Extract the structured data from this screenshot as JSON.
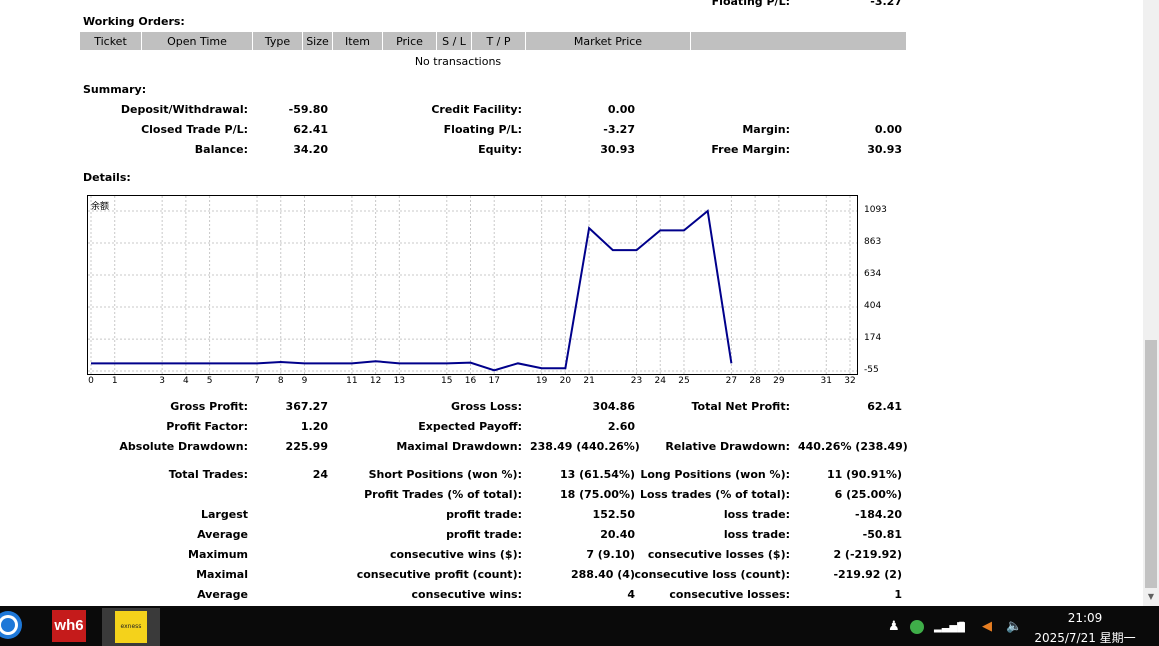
{
  "header_partial": {
    "floating_label": "Floating P/L:",
    "floating_value": "-3.27"
  },
  "working_orders": {
    "title": "Working Orders:",
    "columns": [
      "Ticket",
      "Open Time",
      "Type",
      "Size",
      "Item",
      "Price",
      "S / L",
      "T / P",
      "Market Price",
      ""
    ],
    "empty_text": "No transactions"
  },
  "summary": {
    "title": "Summary:",
    "deposit_label": "Deposit/Withdrawal:",
    "deposit_value": "-59.80",
    "credit_label": "Credit Facility:",
    "credit_value": "0.00",
    "closed_label": "Closed Trade P/L:",
    "closed_value": "62.41",
    "floating_label": "Floating P/L:",
    "floating_value": "-3.27",
    "margin_label": "Margin:",
    "margin_value": "0.00",
    "balance_label": "Balance:",
    "balance_value": "34.20",
    "equity_label": "Equity:",
    "equity_value": "30.93",
    "free_margin_label": "Free Margin:",
    "free_margin_value": "30.93"
  },
  "details": {
    "title": "Details:"
  },
  "chart_data": {
    "type": "line",
    "title": "余额",
    "yticks": [
      "1093",
      "863",
      "634",
      "404",
      "174",
      "-55"
    ],
    "ytick_values": [
      1093,
      863,
      634,
      404,
      174,
      -55
    ],
    "xticks": [
      "0",
      "1",
      "3",
      "4",
      "5",
      "7",
      "8",
      "9",
      "11",
      "12",
      "13",
      "15",
      "16",
      "17",
      "19",
      "20",
      "21",
      "23",
      "24",
      "25",
      "27",
      "28",
      "29",
      "31",
      "32"
    ],
    "ylim": [
      -55,
      1093
    ],
    "x": [
      0,
      1,
      2,
      3,
      4,
      5,
      6,
      7,
      8,
      9,
      10,
      11,
      12,
      13,
      14,
      15,
      16,
      17,
      18,
      19,
      20,
      21,
      22,
      23,
      24,
      25,
      26,
      27
    ],
    "values": [
      0,
      0,
      0,
      0,
      0,
      0,
      0,
      0,
      10,
      0,
      0,
      0,
      15,
      0,
      0,
      0,
      5,
      -50,
      0,
      -35,
      -35,
      970,
      812,
      812,
      954,
      954,
      1093,
      0
    ],
    "line_color": "#00008b",
    "grid": true
  },
  "stats": {
    "gross_profit_label": "Gross Profit:",
    "gross_profit_value": "367.27",
    "gross_loss_label": "Gross Loss:",
    "gross_loss_value": "304.86",
    "total_net_label": "Total Net Profit:",
    "total_net_value": "62.41",
    "profit_factor_label": "Profit Factor:",
    "profit_factor_value": "1.20",
    "expected_payoff_label": "Expected Payoff:",
    "expected_payoff_value": "2.60",
    "abs_dd_label": "Absolute Drawdown:",
    "abs_dd_value": "225.99",
    "max_dd_label": "Maximal Drawdown:",
    "max_dd_value": "238.49 (440.26%)",
    "rel_dd_label": "Relative Drawdown:",
    "rel_dd_value": "440.26% (238.49)",
    "total_trades_label": "Total Trades:",
    "total_trades_value": "24",
    "short_label": "Short Positions (won %):",
    "short_value": "13 (61.54%)",
    "long_label": "Long Positions (won %):",
    "long_value": "11 (90.91%)",
    "profit_trades_label": "Profit Trades (% of total):",
    "profit_trades_value": "18 (75.00%)",
    "loss_trades_label": "Loss trades (% of total):",
    "loss_trades_value": "6 (25.00%)",
    "largest_label": "Largest",
    "largest_profit_label": "profit trade:",
    "largest_profit_value": "152.50",
    "largest_loss_label": "loss trade:",
    "largest_loss_value": "-184.20",
    "average_label": "Average",
    "avg_profit_label": "profit trade:",
    "avg_profit_value": "20.40",
    "avg_loss_label": "loss trade:",
    "avg_loss_value": "-50.81",
    "maximum_label": "Maximum",
    "max_wins_label": "consecutive wins ($):",
    "max_wins_value": "7 (9.10)",
    "max_losses_label": "consecutive losses ($):",
    "max_losses_value": "2 (-219.92)",
    "maximal_label": "Maximal",
    "maximal_profit_label": "consecutive profit (count):",
    "maximal_profit_value": "288.40 (4)",
    "maximal_loss_label": "consecutive loss (count):",
    "maximal_loss_value": "-219.92 (2)",
    "average2_label": "Average",
    "avg_cons_wins_label": "consecutive wins:",
    "avg_cons_wins_value": "4",
    "avg_cons_losses_label": "consecutive losses:",
    "avg_cons_losses_value": "1"
  },
  "taskbar": {
    "app1_label": "wh6",
    "app2_label": "exness",
    "time": "21:09",
    "date": "2025/7/21 星期一"
  }
}
